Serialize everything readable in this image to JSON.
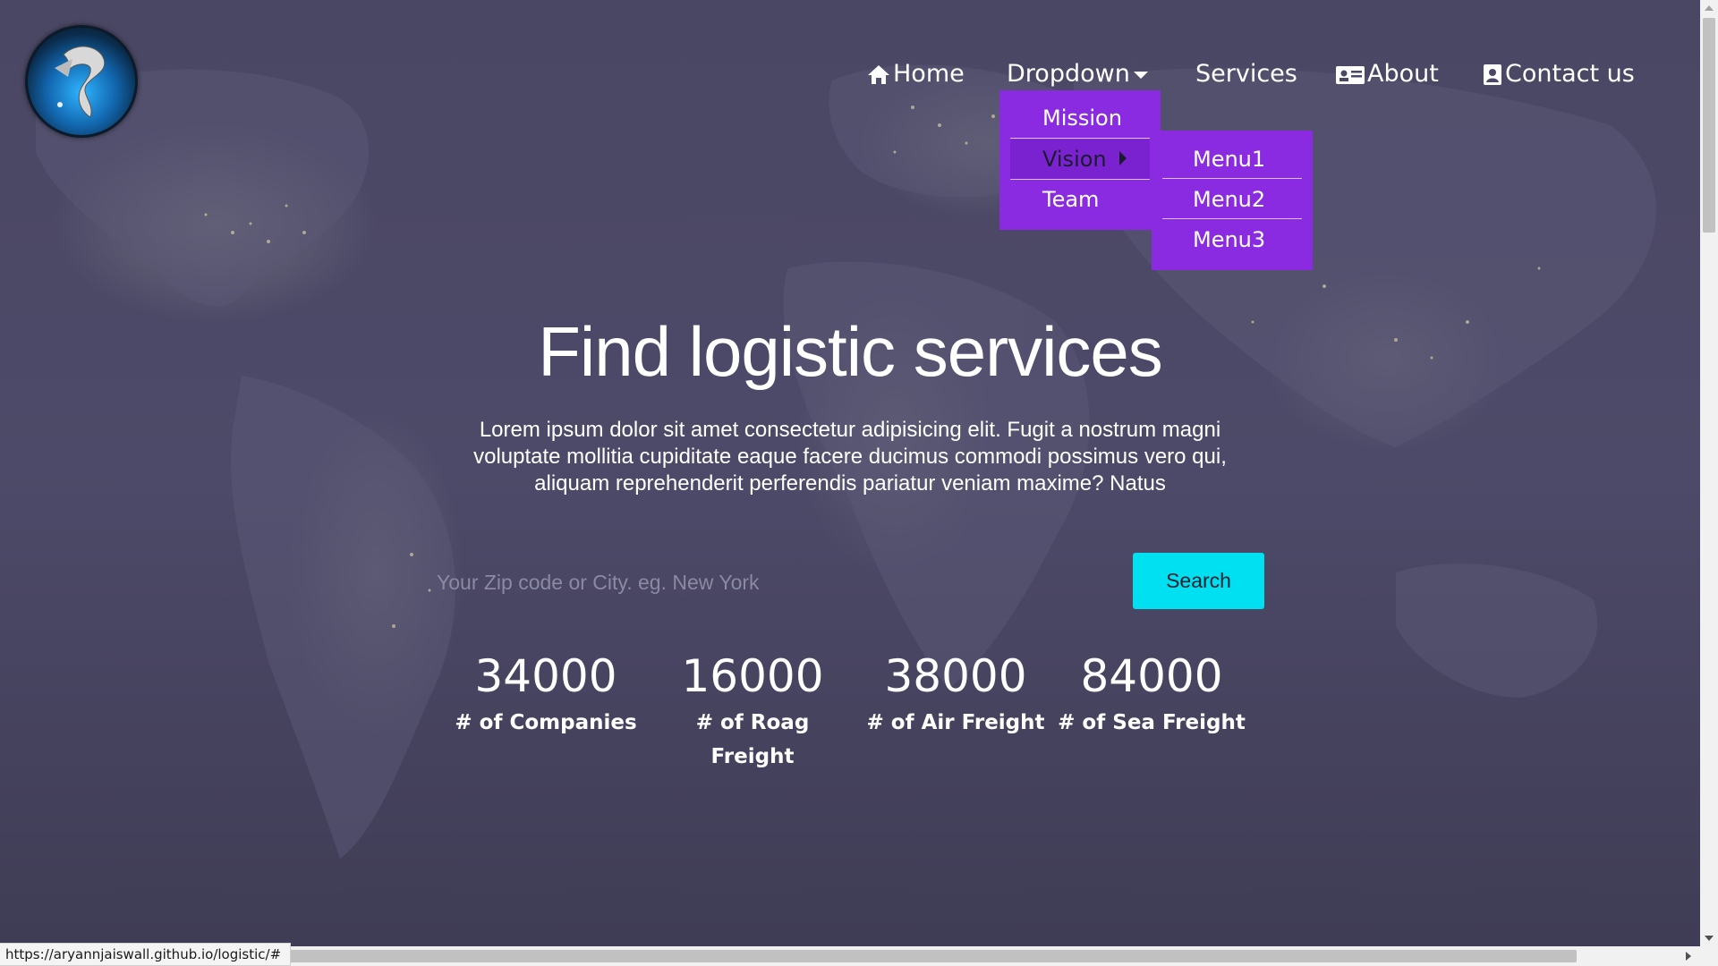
{
  "nav": {
    "items": [
      {
        "label": "Home",
        "icon": "home-icon"
      },
      {
        "label": "Dropdown",
        "icon": "caret-down-icon"
      },
      {
        "label": "Services",
        "icon": ""
      },
      {
        "label": "About",
        "icon": "id-card-icon"
      },
      {
        "label": "Contact us",
        "icon": "contact-icon"
      }
    ]
  },
  "dropdown": {
    "items": [
      "Mission",
      "Vision",
      "Team"
    ],
    "submenu": [
      "Menu1",
      "Menu2",
      "Menu3"
    ]
  },
  "hero": {
    "title": "Find logistic services",
    "text": "Lorem ipsum dolor sit amet consectetur adipisicing elit. Fugit a nostrum magni voluptate mollitia cupiditate eaque facere ducimus commodi possimus vero qui, aliquam reprehenderit perferendis pariatur veniam maxime? Natus"
  },
  "search": {
    "placeholder": "Your Zip code or City. eg. New York",
    "button": "Search"
  },
  "stats": [
    {
      "value": "34000",
      "label": "# of Companies"
    },
    {
      "value": "16000",
      "label": "# of Roag Freight"
    },
    {
      "value": "38000",
      "label": "# of Air Freight"
    },
    {
      "value": "84000",
      "label": "# of Sea Freight"
    }
  ],
  "status_bar": {
    "url": "https://aryannjaiswall.github.io/logistic/#"
  },
  "colors": {
    "menu_purple": "#8a2be2",
    "search_button": "#00e0f0",
    "background": "#4b4866"
  }
}
